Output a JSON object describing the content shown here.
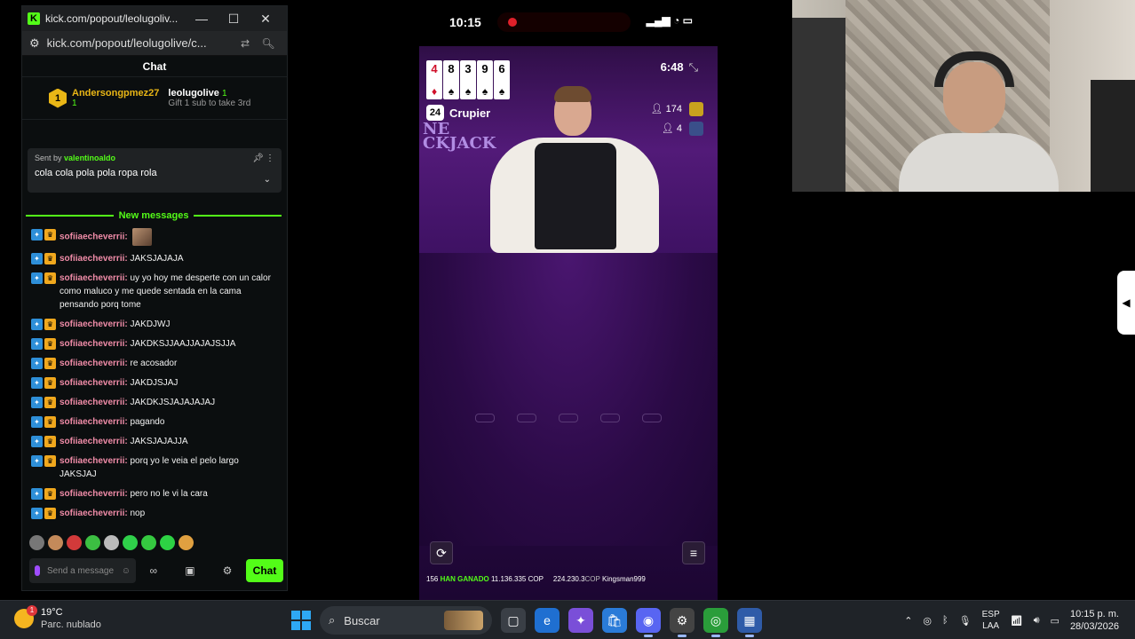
{
  "chat_window": {
    "title": "kick.com/popout/leolugoliv...",
    "url": "kick.com/popout/leolugolive/c...",
    "chat_heading": "Chat",
    "gift": {
      "count_badge": "1",
      "gifter": "Andersongpmez27",
      "gifter_count": "1",
      "receiver": "leolugolive",
      "receiver_count": "1",
      "subtitle": "Gift 1 sub to take 3rd"
    },
    "pinned": {
      "sent_by_label": "Sent by",
      "sent_by_user": "valentinoaldo",
      "message": "cola cola pola pola ropa rola"
    },
    "new_messages_label": "New messages",
    "messages": [
      {
        "user": "sofiiaecheverrii:",
        "text": ""
      },
      {
        "user": "sofiiaecheverrii:",
        "text": "JAKSJAJAJA"
      },
      {
        "user": "sofiiaecheverrii:",
        "text": "uy yo hoy me desperte con un calor como maluco y me quede sentada en la cama pensando porq tome"
      },
      {
        "user": "sofiiaecheverrii:",
        "text": "JAKDJWJ"
      },
      {
        "user": "sofiiaecheverrii:",
        "text": "JAKDKSJJAAJJAJAJSJJA"
      },
      {
        "user": "sofiiaecheverrii:",
        "text": "re acosador"
      },
      {
        "user": "sofiiaecheverrii:",
        "text": "JAKDJSJAJ"
      },
      {
        "user": "sofiiaecheverrii:",
        "text": "JAKDKJSJAJAJAJAJ"
      },
      {
        "user": "sofiiaecheverrii:",
        "text": "pagando"
      },
      {
        "user": "sofiiaecheverrii:",
        "text": "JAKSJAJAJJA"
      },
      {
        "user": "sofiiaecheverrii:",
        "text": "porq yo le veia el pelo largo JAKSJAJ"
      },
      {
        "user": "sofiiaecheverrii:",
        "text": "pero no le vi la cara"
      },
      {
        "user": "sofiiaecheverrii:",
        "text": "nop"
      }
    ],
    "input_placeholder": "Send a message",
    "chat_button": "Chat"
  },
  "phone": {
    "time": "10:15",
    "cards": [
      {
        "rank": "4",
        "suit": "♦",
        "red": true
      },
      {
        "rank": "8",
        "suit": "♠",
        "red": false
      },
      {
        "rank": "3",
        "suit": "♠",
        "red": false
      },
      {
        "rank": "9",
        "suit": "♠",
        "red": false
      },
      {
        "rank": "6",
        "suit": "♠",
        "red": false
      }
    ],
    "dealer_score": "24",
    "dealer_label": "Crupier",
    "timer": "6:48",
    "players_count": "174",
    "seat_count": "4",
    "brand_text": "NE\nCKJACK",
    "ticker_count": "156",
    "ticker_label": "HAN GANADO",
    "ticker_amount": "11.136.335 COP",
    "ticker_amount2": "224.230.3",
    "ticker_cop": "COP",
    "ticker_user": "Kingsman999"
  },
  "taskbar": {
    "temperature": "19°C",
    "weather": "Parc. nublado",
    "weather_badge": "1",
    "search": "Buscar",
    "lang_top": "ESP",
    "lang_bottom": "LAA",
    "time": "10:15 p. m.",
    "date": "28/03/2026"
  }
}
